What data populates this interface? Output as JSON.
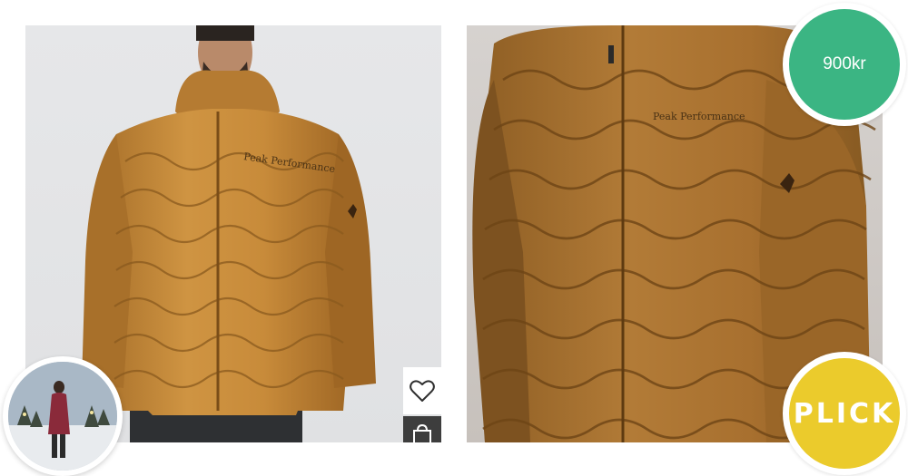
{
  "listing": {
    "price": "900kr",
    "buy_button_label": "PLICK",
    "brand_label": "Peak Performance"
  },
  "icons": {
    "wishlist": "heart-icon",
    "cart": "shopping-bag-icon"
  },
  "colors": {
    "price_badge": "#3bb583",
    "plick_button": "#ebcb2c",
    "jacket": "#c0873a",
    "cart_button_bg": "#3d3d3d"
  }
}
